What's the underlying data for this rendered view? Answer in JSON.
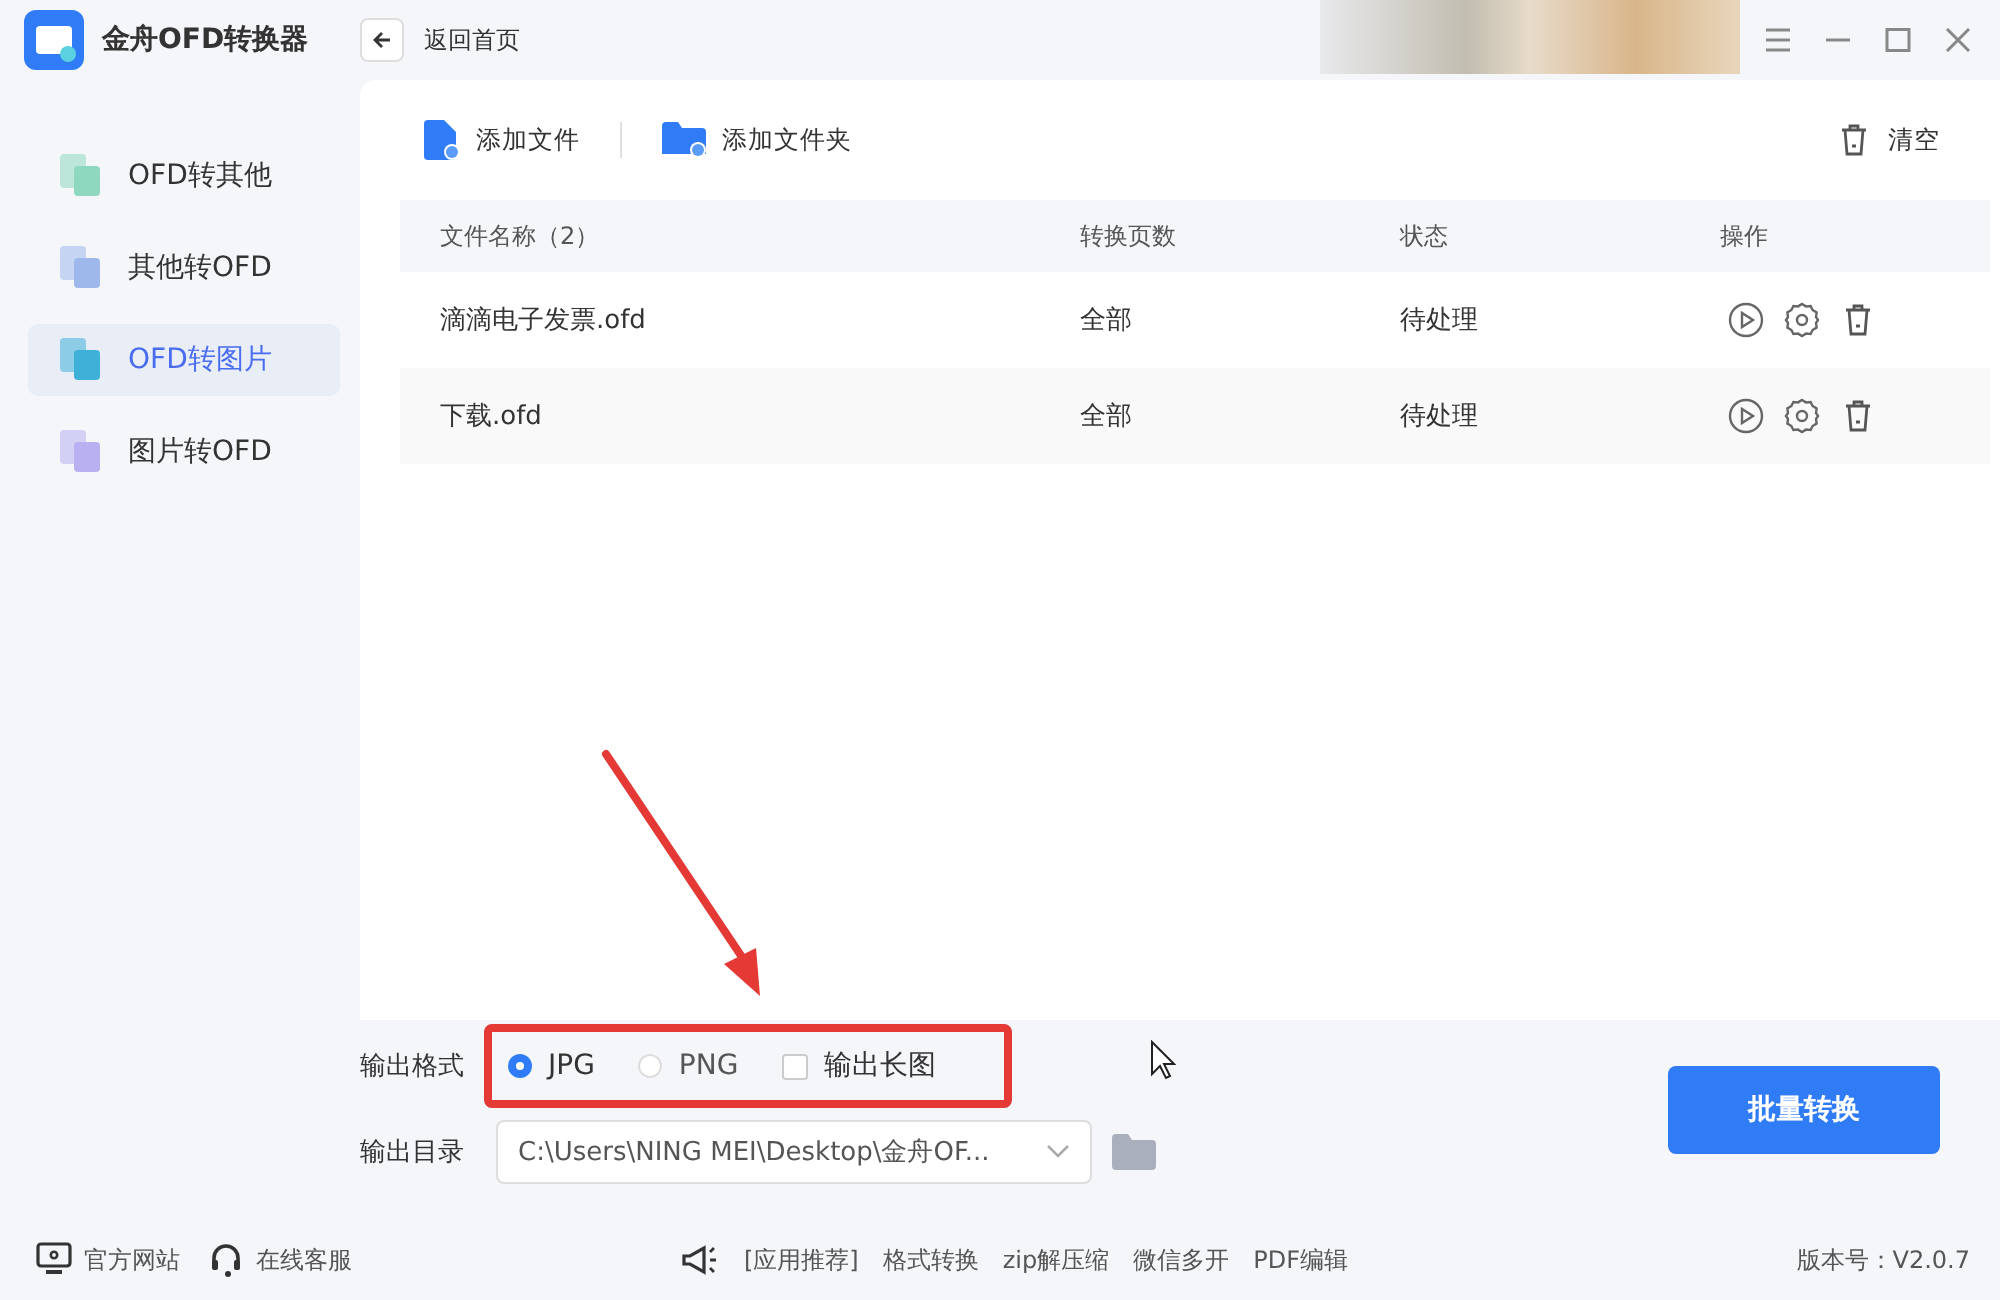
{
  "app": {
    "title": "金舟OFD转换器",
    "back_label": "返回首页"
  },
  "sidebar": {
    "items": [
      {
        "label": "OFD转其他",
        "selected": false,
        "color": "#8fd8c0"
      },
      {
        "label": "其他转OFD",
        "selected": false,
        "color": "#9fb8ec"
      },
      {
        "label": "OFD转图片",
        "selected": true,
        "color": "#3fb0d8"
      },
      {
        "label": "图片转OFD",
        "selected": false,
        "color": "#b8b0f0"
      }
    ]
  },
  "toolbar": {
    "add_file": "添加文件",
    "add_folder": "添加文件夹",
    "clear": "清空"
  },
  "table": {
    "columns": [
      "文件名称（2）",
      "转换页数",
      "状态",
      "操作"
    ],
    "rows": [
      {
        "name": "滴滴电子发票.ofd",
        "pages": "全部",
        "status": "待处理"
      },
      {
        "name": "下载.ofd",
        "pages": "全部",
        "status": "待处理"
      }
    ]
  },
  "output": {
    "format_label": "输出格式",
    "formats": [
      {
        "label": "JPG",
        "selected": true
      },
      {
        "label": "PNG",
        "selected": false
      }
    ],
    "long_image": {
      "label": "输出长图",
      "checked": false
    },
    "dir_label": "输出目录",
    "dir_value": "C:\\Users\\NING MEI\\Desktop\\金舟OF...",
    "convert_button": "批量转换"
  },
  "footer": {
    "links": [
      "官方网站",
      "在线客服"
    ],
    "promo": [
      "[应用推荐]",
      "格式转换",
      "zip解压缩",
      "微信多开",
      "PDF编辑"
    ],
    "version": "版本号：V2.0.7"
  }
}
